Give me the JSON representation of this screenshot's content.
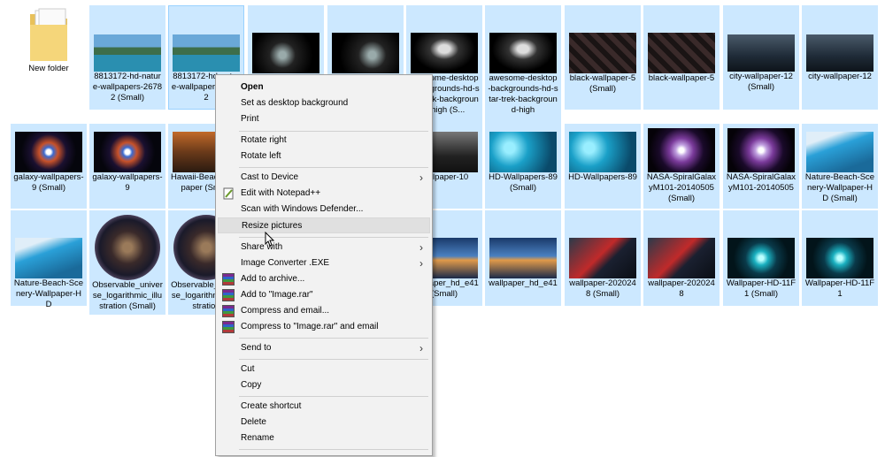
{
  "files": {
    "new_folder": "New folder",
    "f1": "8813172-hd-nature-wallpapers-26782 (Small)",
    "f2": "8813172-hd-nature-wallpapers-26782",
    "f3": "",
    "f4": "",
    "f5": "awesome-desktop-backgrounds-hd-star-trek-background-high (S...",
    "f6": "awesome-desktop-backgrounds-hd-star-trek-background-high",
    "f7": "black-wallpaper-5 (Small)",
    "f8": "black-wallpaper-5",
    "f9": "city-wallpaper-12 (Small)",
    "f10": "city-wallpaper-12",
    "g1": "galaxy-wallpapers-9 (Small)",
    "g2": "galaxy-wallpapers-9",
    "g3": "Hawaii-Beach-Wallpaper (Small)",
    "g5": "wallpaper-10",
    "g6": "HD-Wallpapers-89 (Small)",
    "g7": "HD-Wallpapers-89",
    "g8": "NASA-SpiralGalaxyM101-20140505 (Small)",
    "g9": "NASA-SpiralGalaxyM101-20140505",
    "g10": "Nature-Beach-Scenery-Wallpaper-HD (Small)",
    "h1": "Nature-Beach-Scenery-Wallpaper-HD",
    "h2": "Observable_universe_logarithmic_illustration (Small)",
    "h3": "Observable_universe_logarithmic_illustration",
    "h5": "wallpaper_hd_e41 (Small)",
    "h6": "wallpaper_hd_e41",
    "h7": "wallpaper-2020248 (Small)",
    "h8": "wallpaper-2020248",
    "h9": "Wallpaper-HD-11F1 (Small)",
    "h10": "Wallpaper-HD-11F1"
  },
  "menu": {
    "open": "Open",
    "set_desktop": "Set as desktop background",
    "print": "Print",
    "rotate_right": "Rotate right",
    "rotate_left": "Rotate left",
    "cast": "Cast to Device",
    "notepad": "Edit with Notepad++",
    "defender": "Scan with Windows Defender...",
    "resize": "Resize pictures",
    "share": "Share with",
    "converter": "Image Converter .EXE",
    "add_archive": "Add to archive...",
    "add_rar": "Add to \"Image.rar\"",
    "compress_email": "Compress and email...",
    "compress_rar_email": "Compress to \"Image.rar\" and email",
    "send_to": "Send to",
    "cut": "Cut",
    "copy": "Copy",
    "create_shortcut": "Create shortcut",
    "delete": "Delete",
    "rename": "Rename"
  },
  "colors": {
    "selection": "#cce8ff",
    "menu_bg": "#f2f2f2",
    "highlight": "#e0e0e0"
  }
}
